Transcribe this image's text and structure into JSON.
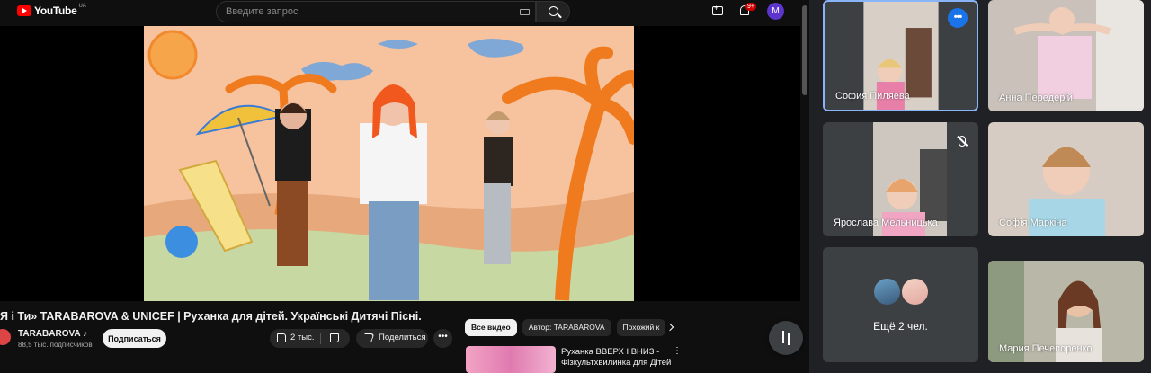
{
  "youtube": {
    "logo_text": "YouTube",
    "country_code": "UA",
    "search_placeholder": "Введите запрос",
    "notif_count": "9+",
    "avatar_letter": "M",
    "video_title": "Я і Ти» TARABAROVA & UNICEF | Руханка для дітей. Українські Дитячі Пісні.",
    "channel_name": "TARABAROVA ♪",
    "subscribers": "88,5 тыс. подписчиков",
    "subscribe_label": "Подписаться",
    "likes": "2 тыс.",
    "share_label": "Поделиться",
    "more_label": "•••",
    "chips": [
      "Все видео",
      "Автор: TARABAROVA",
      "Похожий к"
    ],
    "rec_title": "Руханка ВВЕРХ І ВНИЗ - Фізкультхвилинка для Дітей",
    "rec_more": "⋮"
  },
  "meet": {
    "tiles": [
      {
        "name": "София Пиляева",
        "selected": true
      },
      {
        "name": "Анна Передерій"
      },
      {
        "name": "Ярослава Мельницька",
        "muted": true
      },
      {
        "name": "Софія Маркіна"
      },
      {
        "name": "Ещё 2 чел."
      },
      {
        "name": "Мария Печепоренко"
      }
    ],
    "options_label": "•••"
  },
  "colors": {
    "accent": "#1a73e8",
    "selected_border": "#8ab4f8",
    "yt_red": "#ff0000"
  }
}
